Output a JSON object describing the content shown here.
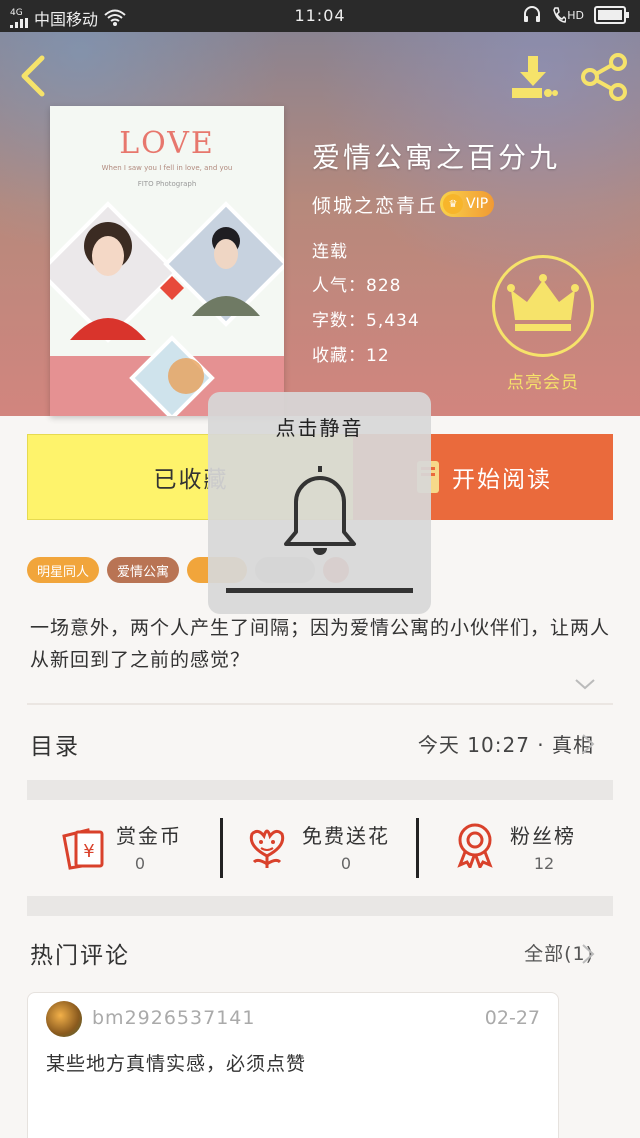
{
  "status_bar": {
    "network": "4G",
    "carrier": "中国移动",
    "time": "11:04",
    "hd_label": "HD",
    "icons": [
      "signal-icon",
      "wifi-icon",
      "headset-icon",
      "call-hd-icon",
      "battery-icon"
    ]
  },
  "header": {
    "back_icon": "chevron-left-icon",
    "download_icon": "download-icon",
    "share_icon": "share-icon"
  },
  "book": {
    "cover_title": "LOVE",
    "cover_line1": "When I saw you I fell in love, and you",
    "cover_line2": "FITO Photograph",
    "title": "爱情公寓之百分九",
    "author": "倾城之恋青丘",
    "vip_label": "VIP",
    "status": "连载",
    "popularity": "人气：828",
    "word_count": "字数：5,434",
    "favorites": "收藏：12",
    "member_label": "点亮会员"
  },
  "actions": {
    "favorite_label": "已收藏",
    "read_label": "开始阅读"
  },
  "tags": [
    {
      "label": "明星同人",
      "color": "#f1a53b"
    },
    {
      "label": "爱情公寓",
      "color": "#b97454"
    },
    {
      "label": "",
      "color": "#f1a53b"
    },
    {
      "label": "",
      "color": "#c9c9c9"
    },
    {
      "label": "",
      "color": "#e26a58"
    }
  ],
  "description": "一场意外，两个人产生了间隔；因为爱情公寓的小伙伴们，让两人从新回到了之前的感觉？",
  "toc": {
    "label": "目录",
    "latest": "今天 10:27 · 真相"
  },
  "stats": [
    {
      "name": "赏金币",
      "value": "0",
      "icon": "red-envelope-icon"
    },
    {
      "name": "免费送花",
      "value": "0",
      "icon": "flower-icon"
    },
    {
      "name": "粉丝榜",
      "value": "12",
      "icon": "medal-icon"
    }
  ],
  "comments": {
    "label": "热门评论",
    "all_label": "全部(1)",
    "items": [
      {
        "user": "bm2926537141",
        "date": "02-27",
        "text": "某些地方真情实感，必须点赞"
      }
    ]
  },
  "toast": {
    "title": "点击静音",
    "icon": "bell-icon"
  },
  "colors": {
    "accent_orange": "#ea6a3c",
    "favorite_yellow": "#fef36b",
    "member_gold": "#f6e36a",
    "icon_red": "#d9412b"
  }
}
